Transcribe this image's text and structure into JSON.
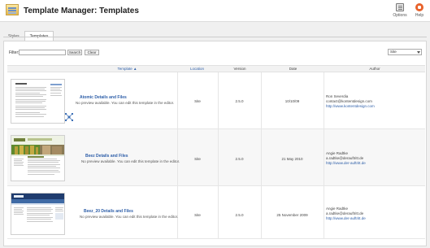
{
  "header": {
    "title": "Template Manager: Templates",
    "options_label": "Options",
    "help_label": "Help"
  },
  "tabs": [
    {
      "label": "Styles"
    },
    {
      "label": "Templates"
    }
  ],
  "filter": {
    "label": "Filter:",
    "value": "",
    "search_label": "Search",
    "clear_label": "Clear",
    "select_value": "Site"
  },
  "table": {
    "headers": {
      "template": "Template ▲",
      "location": "Location",
      "version": "Version",
      "date": "Date",
      "author": "Author"
    },
    "rows": [
      {
        "name": "Atomic Details and Files",
        "description": "No preview available. You can edit this template in the editor.",
        "location": "Site",
        "version": "2.5.0",
        "date": "10/10/09",
        "author_name": "Ron Severdia",
        "author_email": "contact@kontentdesign.com",
        "author_url": "http://www.kontentdesign.com"
      },
      {
        "name": "Beez Details and Files",
        "description": "No preview available. You can edit this template in the editor.",
        "location": "Site",
        "version": "2.5.0",
        "date": "21 May 2010",
        "author_name": "Angie Radtke",
        "author_email": "a.radtke@derauftritt.de",
        "author_url": "http://www.der-auftritt.de"
      },
      {
        "name": "Beez_20 Details and Files",
        "description": "No preview available. You can edit this template in the editor.",
        "location": "Site",
        "version": "2.5.0",
        "date": "25 November 2009",
        "author_name": "Angie Radtke",
        "author_email": "a.radtke@derauftritt.de",
        "author_url": "http://www.der-auftritt.de"
      }
    ]
  }
}
